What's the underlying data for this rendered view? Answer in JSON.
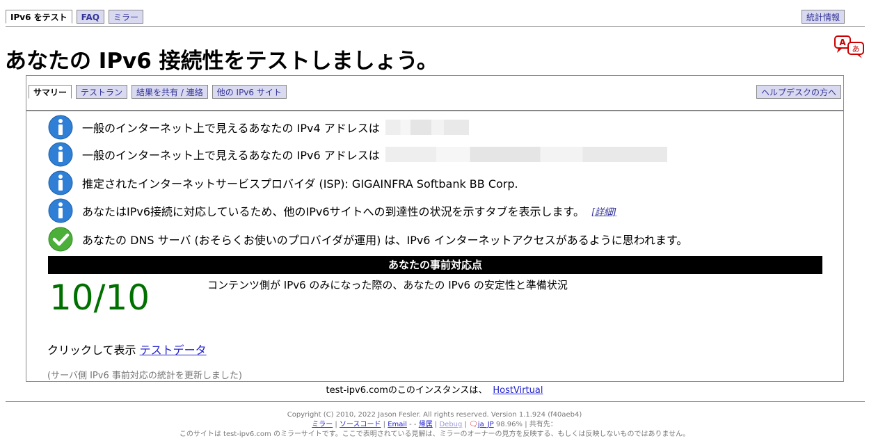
{
  "top_tabs": [
    "IPv6 をテスト",
    "FAQ",
    "ミラー"
  ],
  "stats_tab": "統計情報",
  "page_title": "あなたの IPv6 接続性をテストしましょう。",
  "inner_tabs": [
    "サマリー",
    "テストラン",
    "結果を共有 / 連絡",
    "他の IPv6 サイト"
  ],
  "help_tab": "ヘルプデスクの方へ",
  "info": [
    {
      "text": "一般のインターネット上で見えるあなたの IPv4 アドレスは",
      "icon": "info-icon"
    },
    {
      "text": "一般のインターネット上で見えるあなたの IPv6 アドレスは",
      "icon": "info-icon"
    },
    {
      "text": "推定されたインターネットサービスプロバイダ (ISP): GIGAINFRA Softbank BB Corp.",
      "icon": "info-icon"
    },
    {
      "text": "あなたはIPv6接続に対応しているため、他のIPv6サイトへの到達性の状況を示すタブを表示します。",
      "icon": "info-icon",
      "link": "[詳細]"
    },
    {
      "text": "あなたの DNS サーバ (おそらくお使いのプロバイダが運用) は、IPv6 インターネットアクセスがあるように思われます。",
      "icon": "check-icon"
    }
  ],
  "readiness_title": "あなたの事前対応点",
  "score": "10/10",
  "score_desc": "コンテンツ側が IPv6 のみになった際の、あなたの IPv6 の安定性と準備状況",
  "click_text": "クリックして表示",
  "test_data_link": "テストデータ",
  "server_note": "(サーバ側 IPv6 事前対応の統計を更新しました)",
  "host_text": "test-ipv6.comのこのインスタンスは、",
  "host_link": "HostVirtual",
  "footer": {
    "copyright": "Copyright (C) 2010, 2022 Jason Fesler. All rights reserved. Version 1.1.924 (f40aeb4)",
    "mirror": "ミラー",
    "source": "ソースコード",
    "email": "Email",
    "attribution": "帰属",
    "debug": "Debug",
    "locale": "ja_JP",
    "percent": "98.96%",
    "sponsor": "共有先：",
    "disclaimer": "このサイトは test-ipv6.com のミラーサイトです。ここで表明されている見解は、ミラーのオーナーの見方を反映する、もしくは反映しないものではありません。"
  },
  "colors": {
    "accent": "#333399",
    "score": "#007000",
    "tab_bg": "#d9d9ef"
  }
}
